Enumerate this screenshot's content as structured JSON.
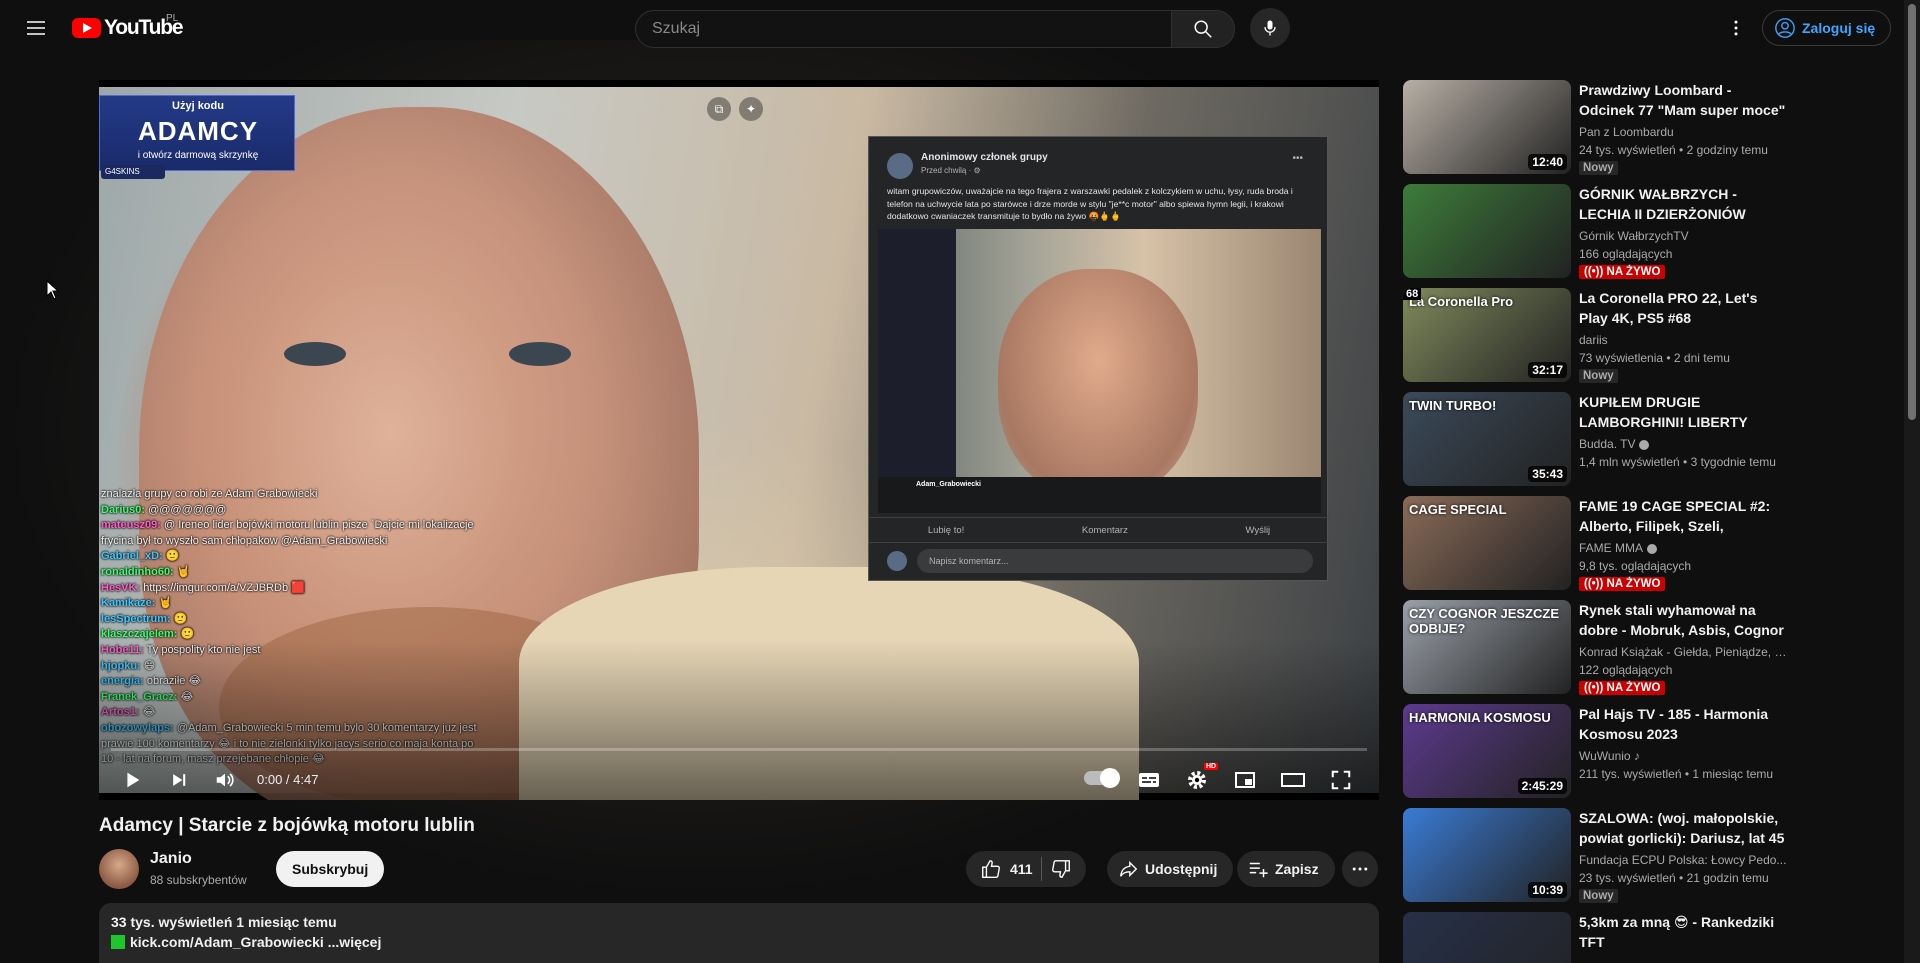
{
  "header": {
    "logo_text": "YouTube",
    "country_code": "PL",
    "search_placeholder": "Szukaj",
    "signin_label": "Zaloguj się"
  },
  "player": {
    "overlay": {
      "promo_top": "Użyj kodu",
      "promo_code": "ADAMCY",
      "promo_sub": "i otwórz darmową skrzynkę",
      "promo_brand": "G4SKINS",
      "fb_author": "Anonimowy członek grupy",
      "fb_time": "Przed chwilą · ⚙",
      "fb_text": "witam grupowiczów, uważajcie na tego frajera z warszawki pedalek z kolczykiem w uchu, łysy, ruda broda i telefon na uchwycie lata po starówce i drze morde w stylu \"je**c motor\" albo spiewa hymn legii, i krakowi dodatkowo cwaniaczek transmituje to bydło na żywo 🤬🖕🖕",
      "fb_stream_name": "Adam_Grabowiecki",
      "fb_like": "Lubię to!",
      "fb_comment": "Komentarz",
      "fb_share": "Wyślij",
      "fb_comment_placeholder": "Napisz komentarz...",
      "chat": [
        {
          "name": "",
          "text": "znalazła grupy co robi ze Adam Grabowiecki"
        },
        {
          "name": "Darius0:",
          "text": "@@@@@@@"
        },
        {
          "name": "mateusz09:",
          "text": "@ Ireneo lider bojówki motoru lublin pisze `Dajcie mi lokalizacje"
        },
        {
          "name": "",
          "text": "frycina był to wyszło sam chłopakow @Adam_Grabowiecki"
        },
        {
          "name": "Gabriel_xD:",
          "text": "🙂"
        },
        {
          "name": "ronaldinho60:",
          "text": "🤘"
        },
        {
          "name": "HesVK:",
          "text": "https://imgur.com/a/VZJBRDb 🟥"
        },
        {
          "name": "Kamikaze:",
          "text": "🤘"
        },
        {
          "name": "lesSpectrum:",
          "text": "🙂"
        },
        {
          "name": "klaszczajelem:",
          "text": "🙂"
        },
        {
          "name": "Hobe11:",
          "text": "Ty pospolity kto nie jest"
        },
        {
          "name": "hjopku:",
          "text": "😄"
        },
        {
          "name": "energia:",
          "text": "obraziłe 😂"
        },
        {
          "name": "Franek_Gracz:",
          "text": "😂"
        },
        {
          "name": "Artos1:",
          "text": "😂"
        },
        {
          "name": "obozowylaps:",
          "text": "@Adam_Grabowiecki 5 min temu bylo 30 komentarzy juz jest"
        },
        {
          "name": "",
          "text": "prawie 100 komentarzy 😂 i to nie zielonki tylko jacys serio co maja konta po"
        },
        {
          "name": "",
          "text": "10 - lat na forum, masz przejebane chłopie 😂"
        }
      ]
    },
    "time_current": "0:00",
    "time_total": "4:47",
    "progress": 0.0
  },
  "video": {
    "title": "Adamcy | Starcie z bojówką motoru lublin",
    "channel": "Janio",
    "subscribers": "88 subskrybentów",
    "subscribe_label": "Subskrybuj",
    "likes": "411",
    "share_label": "Udostępnij",
    "save_label": "Zapisz",
    "views_date": "33 tys. wyświetleń  1 miesiąc temu",
    "desc_link": "kick.com/Adam_Grabowiecki ...więcej"
  },
  "recommendations": [
    {
      "title": "Prawdziwy Loombard - Odcinek 77 \"Mam super moce\"",
      "channel": "Pan z Loombardu",
      "meta": "24 tys. wyświetleń  • 2 godziny temu",
      "duration": "12:40",
      "badge": "Nowy",
      "live": false,
      "verified": false,
      "thumb_color": "#b8b0a6"
    },
    {
      "title": "GÓRNIK WAŁBRZYCH - LECHIA II DZIERŻONIÓW",
      "channel": "Górnik WałbrzychTV",
      "meta": "166 oglądających",
      "duration": "",
      "badge": "NA ŻYWO",
      "live": true,
      "verified": false,
      "thumb_color": "#3d7c3a"
    },
    {
      "title": "La Coronella PRO 22, Let's Play 4K, PS5 #68",
      "channel": "dariis",
      "meta": "73 wyświetlenia  • 2 dni temu",
      "duration": "32:17",
      "badge": "Nowy",
      "live": false,
      "verified": false,
      "thumb_color": "#7f8a5c",
      "thumb_text": "La Coronella Pro",
      "thumb_num": "68"
    },
    {
      "title": "KUPIŁEM DRUGIE LAMBORGHINI! LIBERTY WAL...",
      "channel": "Budda. TV",
      "meta": "1,4 mln wyświetleń  • 3 tygodnie temu",
      "duration": "35:43",
      "badge": "",
      "live": false,
      "verified": true,
      "thumb_color": "#3b4a5a",
      "thumb_text": "TWIN TURBO!"
    },
    {
      "title": "FAME 19 CAGE SPECIAL #2: Alberto, Filipek, Szeli, Zadyma,...",
      "channel": "FAME MMA",
      "meta": "9,8 tys. oglądających",
      "duration": "",
      "badge": "NA ŻYWO",
      "live": true,
      "verified": true,
      "thumb_color": "#8a6b58",
      "thumb_text": "CAGE SPECIAL"
    },
    {
      "title": "Rynek stali wyhamował na dobre - Mobruk, Asbis, Cognor",
      "channel": "Konrad Książak - Giełda, Pieniądze, I...",
      "meta": "122 oglądających",
      "duration": "",
      "badge": "NA ŻYWO",
      "live": true,
      "verified": false,
      "thumb_color": "#9aa0a8",
      "thumb_text": "CZY COGNOR JESZCZE ODBIJE?"
    },
    {
      "title": "Pal Hajs TV - 185 - Harmonia Kosmosu 2023",
      "channel": "WuWunio ♪",
      "meta": "211 tys. wyświetleń  • 1 miesiąc temu",
      "duration": "2:45:29",
      "badge": "",
      "live": false,
      "verified": false,
      "thumb_color": "#5d3a8f",
      "thumb_text": "HARMONIA KOSMOSU"
    },
    {
      "title": "SZALOWA: (woj. małopolskie, powiat gorlicki): Dariusz, lat 45",
      "channel": "Fundacja ECPU Polska: Łowcy Pedo...",
      "meta": "23 tys. wyświetleń  • 21 godzin temu",
      "duration": "10:39",
      "badge": "Nowy",
      "live": false,
      "verified": false,
      "thumb_color": "#3a7bd5"
    },
    {
      "title": "5,3km za mną 😎 - Rankedziki TFT",
      "channel": "",
      "meta": "",
      "duration": "",
      "badge": "",
      "live": false,
      "verified": false,
      "thumb_color": "#26304a"
    }
  ],
  "icons": {
    "menu": "menu-icon",
    "search": "search-icon",
    "mic": "mic-icon",
    "more": "more-vert-icon",
    "account": "account-icon",
    "play": "play-icon",
    "next": "next-icon",
    "volume": "volume-icon",
    "subtitles": "subtitles-icon",
    "settings": "gear-icon",
    "miniplayer": "miniplayer-icon",
    "theater": "theater-icon",
    "fullscreen": "fullscreen-icon",
    "like": "thumb-up-icon",
    "dislike": "thumb-down-icon",
    "share": "share-icon",
    "save": "playlist-add-icon"
  },
  "colors": {
    "brand": "#ff0000",
    "link": "#3ea6ff",
    "live": "#cc0000",
    "kick": "#1ec62b"
  }
}
